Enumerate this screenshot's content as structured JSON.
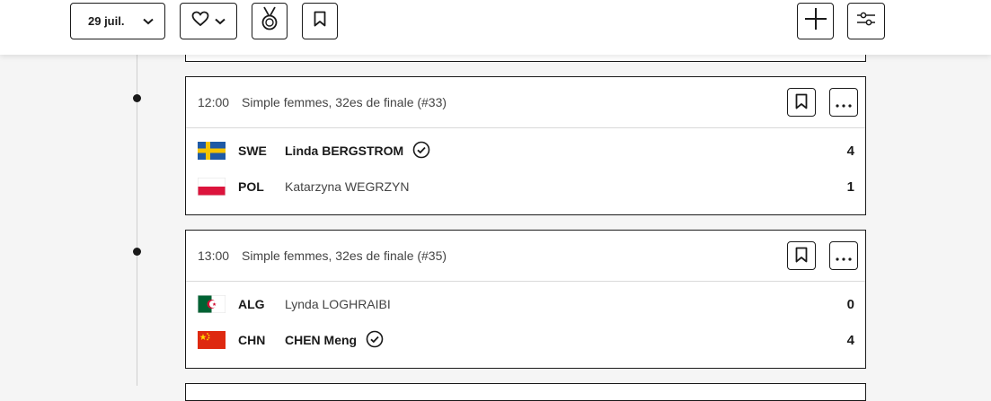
{
  "toolbar": {
    "date_label": "29 juil.",
    "icons": [
      "chevron-down-icon",
      "heart-icon",
      "medal-icon",
      "bookmark-icon",
      "plus-icon",
      "filter-sliders-icon"
    ]
  },
  "matches": [
    {
      "time": "12:00",
      "event": "Simple femmes, 32es de finale (#33)",
      "players": [
        {
          "code": "SWE",
          "name": "Linda BERGSTROM",
          "score": "4",
          "winner": true
        },
        {
          "code": "POL",
          "name": "Katarzyna WEGRZYN",
          "score": "1",
          "winner": false
        }
      ]
    },
    {
      "time": "13:00",
      "event": "Simple femmes, 32es de finale (#35)",
      "players": [
        {
          "code": "ALG",
          "name": "Lynda LOGHRAIBI",
          "score": "0",
          "winner": false
        },
        {
          "code": "CHN",
          "name": "CHEN Meng",
          "score": "4",
          "winner": true
        }
      ]
    }
  ],
  "colors": {
    "border": "#1a1a1a",
    "background": "#f5f5f5",
    "card": "#ffffff"
  }
}
